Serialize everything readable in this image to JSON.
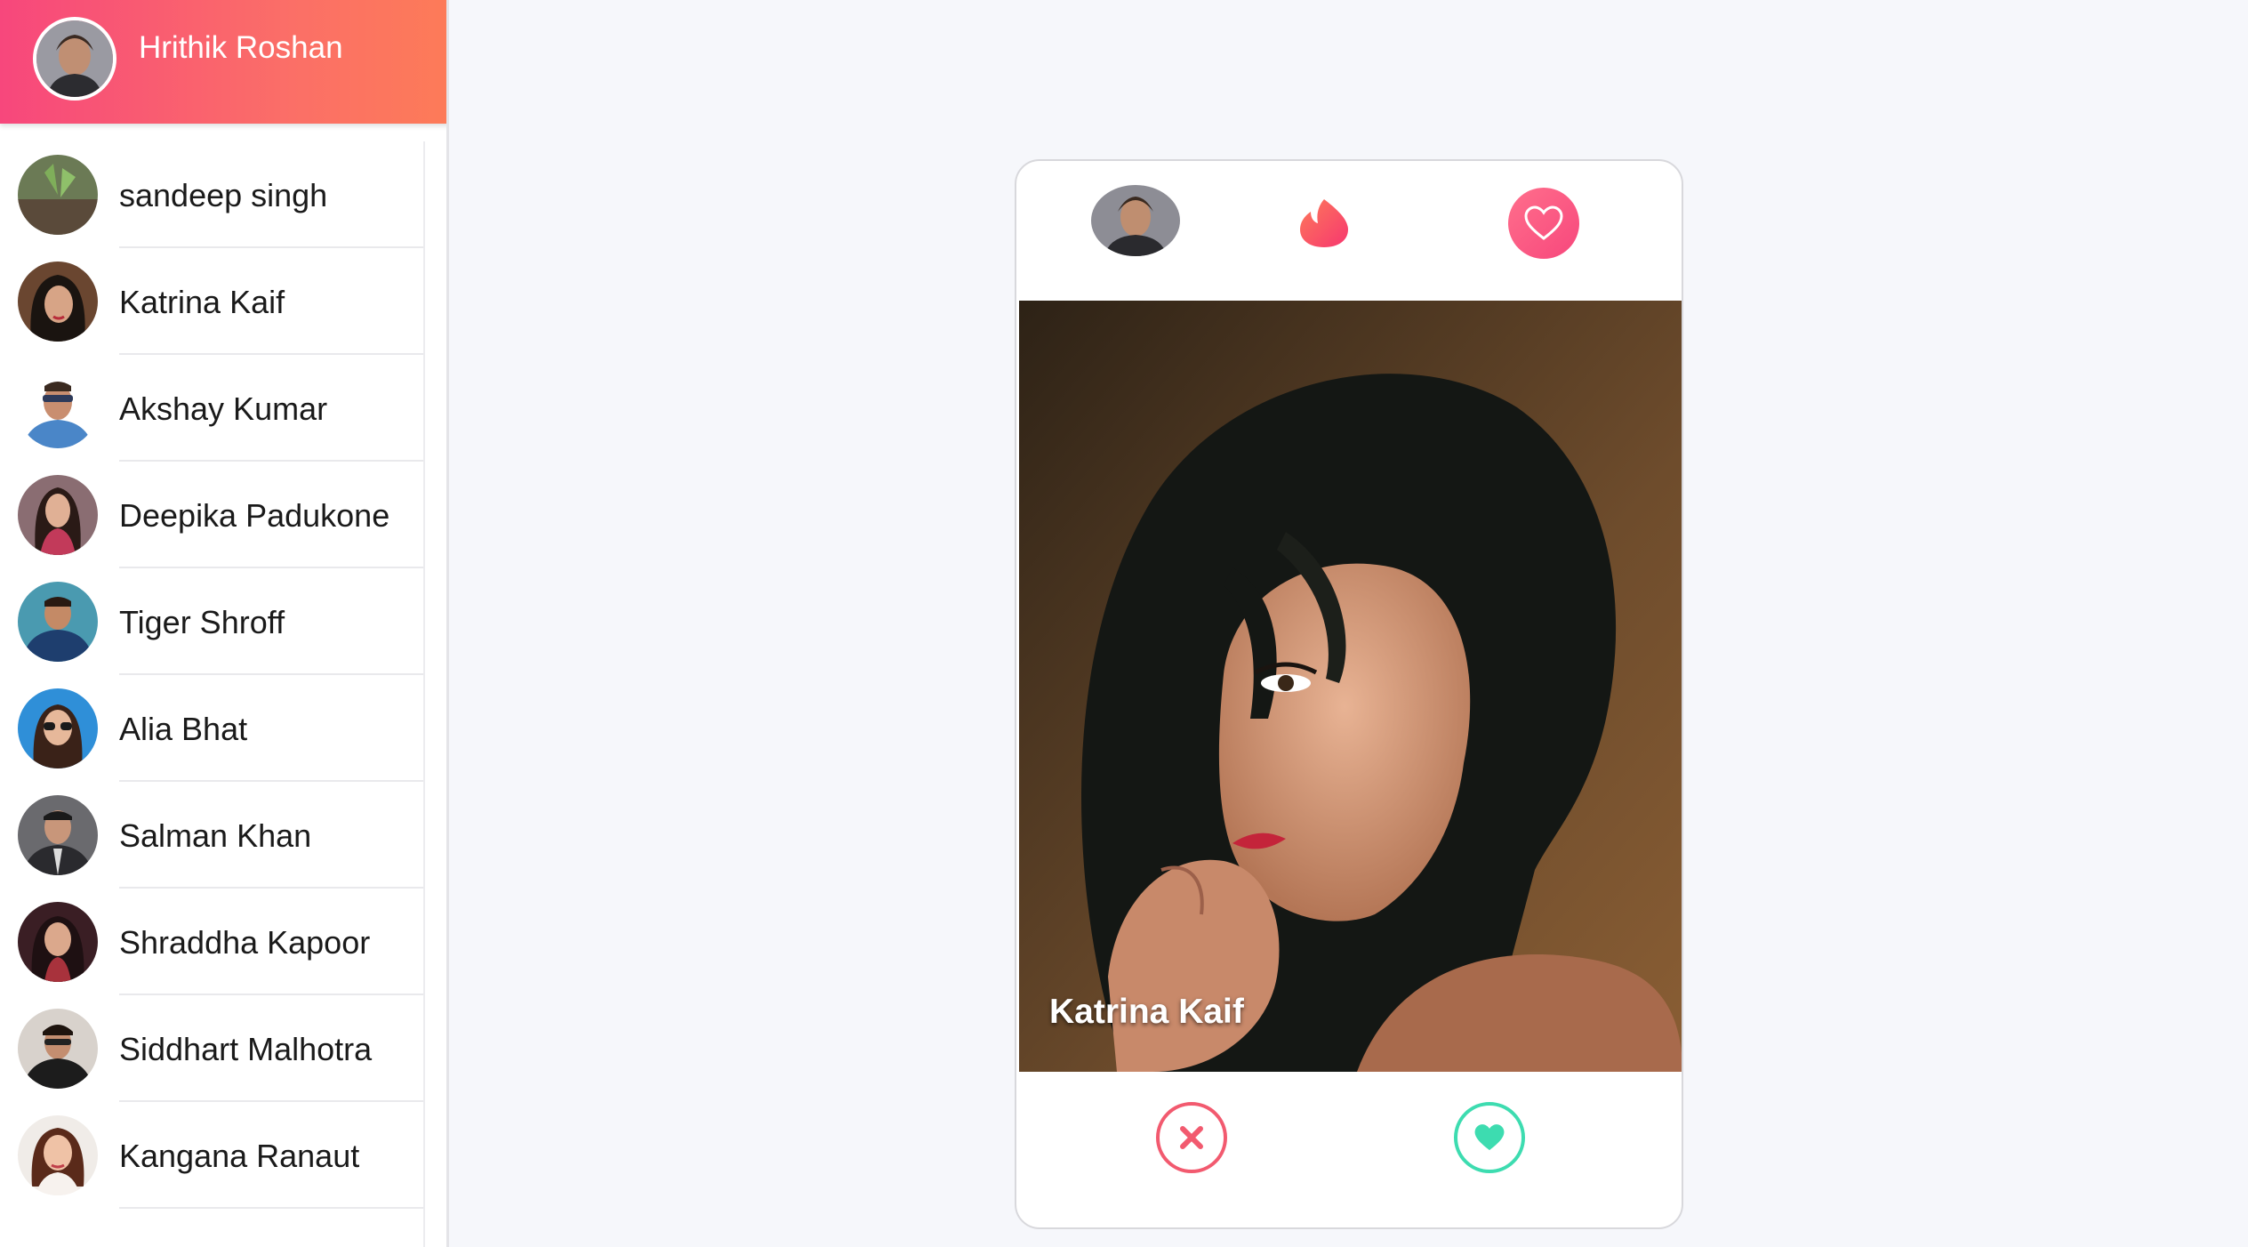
{
  "colors": {
    "brand_gradient_start": "#f7477c",
    "brand_gradient_end": "#fd7b58",
    "nope": "#f25a6f",
    "like": "#3ddcb0",
    "background": "#f6f7fb"
  },
  "user": {
    "name": "Hrithik Roshan",
    "avatar_icon": "user-avatar"
  },
  "contacts": [
    {
      "name": "sandeep singh"
    },
    {
      "name": "Katrina Kaif"
    },
    {
      "name": "Akshay Kumar"
    },
    {
      "name": "Deepika Padukone"
    },
    {
      "name": "Tiger Shroff"
    },
    {
      "name": "Alia Bhat"
    },
    {
      "name": "Salman Khan"
    },
    {
      "name": "Shraddha Kapoor"
    },
    {
      "name": "Siddhart Malhotra"
    },
    {
      "name": "Kangana Ranaut"
    }
  ],
  "card": {
    "profile_name": "Katrina Kaif",
    "icons": {
      "top_left": "user-avatar",
      "center": "flame-icon",
      "top_right": "heart-icon",
      "dislike": "close-icon",
      "like": "heart-icon"
    }
  }
}
